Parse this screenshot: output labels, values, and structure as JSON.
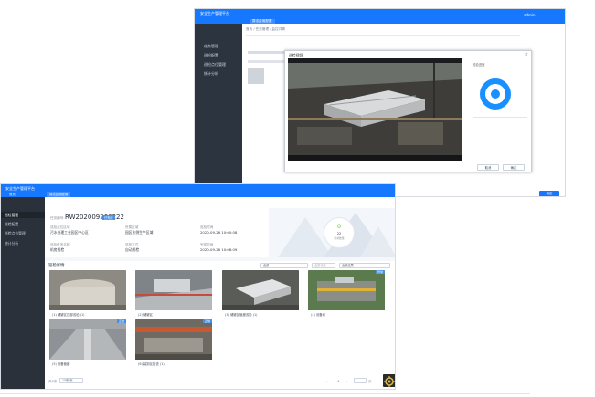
{
  "back_window": {
    "title": "安全生产管理平台",
    "user": "admin",
    "tab_label": "算法应用配置",
    "breadcrumb": "首页 / 任务管理 / 监控详情",
    "menu": [
      "任务管理",
      "巡检配置",
      "巡检点位管理",
      "统计分析"
    ],
    "modal": {
      "title": "巡检视频",
      "side_label": "巡检进度",
      "cancel_label": "取消",
      "ok_label": "确定"
    },
    "confirm_label": "确定"
  },
  "main_window": {
    "title": "安全生产管理平台",
    "user_label": "首页",
    "tab_label": "算法应用配置",
    "breadcrumb": [
      "首页应用",
      "任务管理",
      "巡检结果详情"
    ],
    "menu": [
      "巡检管理",
      "巡检配置",
      "巡检点位管理",
      "统计分析"
    ],
    "task": {
      "code_label": "任务编号:",
      "code": "RW202009260222",
      "status": "已完成",
      "fields": [
        {
          "label": "巡检点位区域",
          "value": "污水处理工业园区中心区"
        },
        {
          "label": "所属区域",
          "value": "园区东侧生产区域"
        },
        {
          "label": "巡检时间",
          "value": "2020-09-26 10:00:08"
        },
        {
          "label": "巡检任务名称",
          "value": "机房巡检"
        },
        {
          "label": "巡检方式",
          "value": "自动巡检"
        },
        {
          "label": "完成时间",
          "value": "2020-09-26 10:08:09"
        }
      ],
      "score": "0",
      "score_sub": "22",
      "score_note": "异常数量"
    },
    "section_title": "巡检详情",
    "filters": [
      "全部",
      "全部状态",
      "全部结果"
    ],
    "cards": [
      {
        "caption": "(1) 储罐区顶部巡检  (1)",
        "badge": ""
      },
      {
        "caption": "(2) 储罐区",
        "badge": ""
      },
      {
        "caption": "(3) 储罐区管廊巡检  (1)",
        "badge": ""
      },
      {
        "caption": "(4) 设备间",
        "badge": "异常"
      },
      {
        "caption": "(5) 设备管廊",
        "badge": "正常"
      },
      {
        "caption": "(6) 装卸区检查  (1)",
        "badge": "正常"
      }
    ],
    "pagination": {
      "total": "共6条",
      "page_size": "10条/页",
      "current": "1",
      "goto_label": "前往",
      "page_unit": "页"
    }
  },
  "colors": {
    "brand": "#1677ff",
    "sidebar": "#2b313b",
    "accent_ring": "#1890ff",
    "badge_ok": "#4a90e2"
  }
}
